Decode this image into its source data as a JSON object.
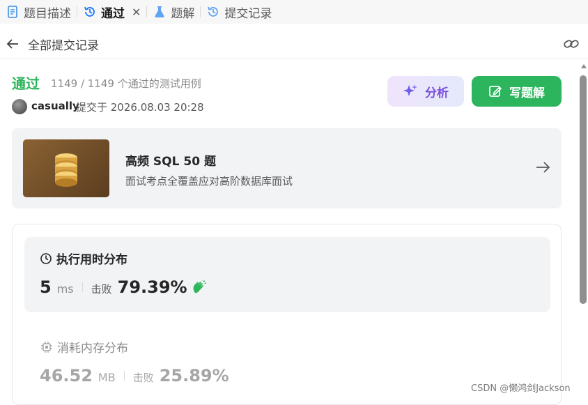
{
  "tabs": [
    {
      "label": "题目描述",
      "icon": "document-icon"
    },
    {
      "label": "通过",
      "icon": "history-icon",
      "active": true
    },
    {
      "label": "题解",
      "icon": "flask-icon"
    },
    {
      "label": "提交记录",
      "icon": "history-icon"
    }
  ],
  "header": {
    "back_icon": "arrow-left-icon",
    "title": "全部提交记录",
    "link_icon": "link-icon"
  },
  "submission": {
    "status": "通过",
    "cases": "1149 / 1149 个通过的测试用例",
    "user": "casually",
    "submitted": "提交于 2026.08.03 20:28"
  },
  "actions": {
    "analyze": "分析",
    "write": "写题解"
  },
  "promo": {
    "title": "高频 SQL 50 题",
    "desc": "面试考点全覆盖应对高阶数据库面试"
  },
  "runtime": {
    "title": "执行用时分布",
    "value": "5",
    "unit": "ms",
    "beat_label": "击败",
    "beat": "79.39%"
  },
  "memory": {
    "title": "消耗内存分布",
    "value": "46.52",
    "unit": "MB",
    "beat_label": "击败",
    "beat": "25.89%"
  },
  "watermark": "CSDN @懒鸿剑Jackson",
  "colors": {
    "accent_green": "#2db55d",
    "analyze_purple": "#7a4fe0",
    "tab_bg": "#f7f7f8",
    "card_bg": "#f2f3f5"
  }
}
